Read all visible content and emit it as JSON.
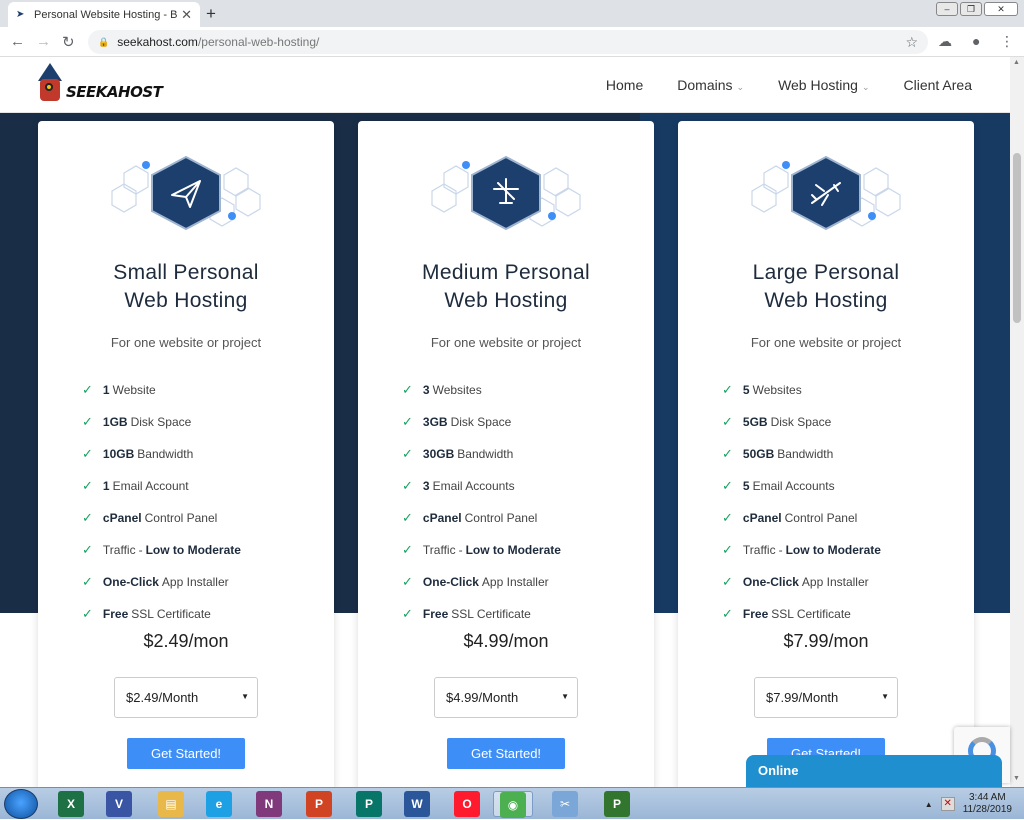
{
  "browser": {
    "tab_title": "Personal Website Hosting - Best",
    "url_host": "seekahost.com",
    "url_path": "/personal-web-hosting/"
  },
  "site": {
    "logo_text": "SEEKAHOST",
    "nav": [
      {
        "label": "Home",
        "dropdown": false
      },
      {
        "label": "Domains",
        "dropdown": true
      },
      {
        "label": "Web Hosting",
        "dropdown": true
      },
      {
        "label": "Client Area",
        "dropdown": false
      }
    ]
  },
  "plans": [
    {
      "title_line1": "Small Personal",
      "title_line2": "Web Hosting",
      "icon": "paper-plane-icon",
      "subtitle": "For one website or project",
      "features": [
        {
          "bold": "1",
          "text": "Website"
        },
        {
          "bold": "1GB",
          "text": "Disk Space"
        },
        {
          "bold": "10GB",
          "text": "Bandwidth"
        },
        {
          "bold": "1",
          "text": "Email Account"
        },
        {
          "bold": "cPanel",
          "text": "Control Panel"
        },
        {
          "pre": "Traffic",
          "bold": "Low to Moderate"
        },
        {
          "bold": "One-Click",
          "text": "App Installer"
        },
        {
          "bold": "Free",
          "text": "SSL Certificate"
        }
      ],
      "price": "$2.49/mon",
      "select_value": "$2.49/Month",
      "button": "Get Started!"
    },
    {
      "title_line1": "Medium Personal",
      "title_line2": "Web Hosting",
      "icon": "drone-icon",
      "subtitle": "For one website or project",
      "features": [
        {
          "bold": "3",
          "text": "Websites"
        },
        {
          "bold": "3GB",
          "text": "Disk Space"
        },
        {
          "bold": "30GB",
          "text": "Bandwidth"
        },
        {
          "bold": "3",
          "text": "Email Accounts"
        },
        {
          "bold": "cPanel",
          "text": "Control Panel"
        },
        {
          "pre": "Traffic",
          "bold": "Low to Moderate"
        },
        {
          "bold": "One-Click",
          "text": "App Installer"
        },
        {
          "bold": "Free",
          "text": "SSL Certificate"
        }
      ],
      "price": "$4.99/mon",
      "select_value": "$4.99/Month",
      "button": "Get Started!"
    },
    {
      "title_line1": "Large Personal",
      "title_line2": "Web Hosting",
      "icon": "airplane-icon",
      "subtitle": "For one website or project",
      "features": [
        {
          "bold": "5",
          "text": "Websites"
        },
        {
          "bold": "5GB",
          "text": "Disk Space"
        },
        {
          "bold": "50GB",
          "text": "Bandwidth"
        },
        {
          "bold": "5",
          "text": "Email Accounts"
        },
        {
          "bold": "cPanel",
          "text": "Control Panel"
        },
        {
          "pre": "Traffic",
          "bold": "Low to Moderate"
        },
        {
          "bold": "One-Click",
          "text": "App Installer"
        },
        {
          "bold": "Free",
          "text": "SSL Certificate"
        }
      ],
      "price": "$7.99/mon",
      "select_value": "$7.99/Month",
      "button": "Get Started!"
    }
  ],
  "chat": {
    "label": "Online"
  },
  "taskbar": {
    "apps": [
      "excel-icon",
      "visio-icon",
      "explorer-icon",
      "internet-explorer-icon",
      "onenote-icon",
      "powerpoint-icon",
      "publisher-icon",
      "word-icon",
      "opera-icon",
      "chrome-icon",
      "snipping-tool-icon",
      "project-icon"
    ],
    "time": "3:44 AM",
    "date": "11/28/2019"
  },
  "colors": {
    "hero_dark": "#1a2d47",
    "hero_blue": "#173a63",
    "button": "#3e8ef7",
    "check": "#1aa15f",
    "chat": "#1f8fd0"
  }
}
